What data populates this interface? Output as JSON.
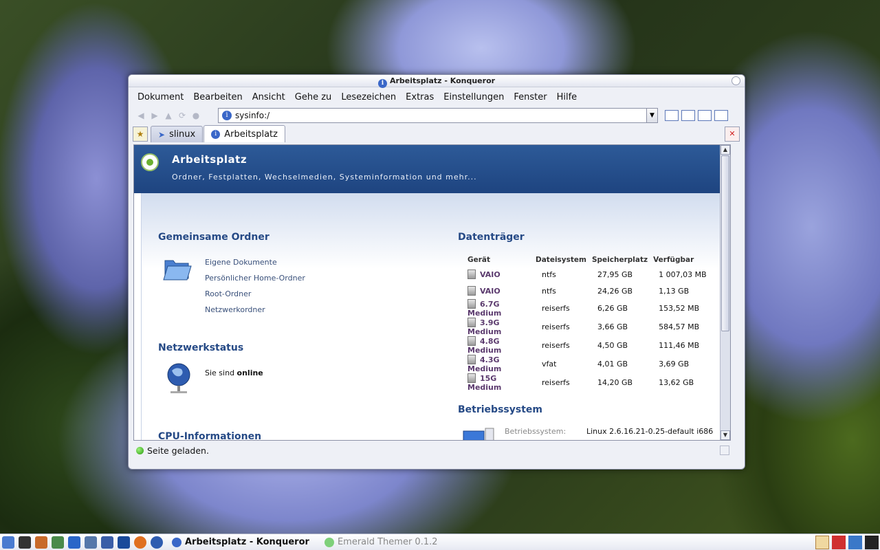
{
  "window": {
    "title": "Arbeitsplatz -  Konqueror"
  },
  "menu": [
    "Dokument",
    "Bearbeiten",
    "Ansicht",
    "Gehe zu",
    "Lesezeichen",
    "Extras",
    "Einstellungen",
    "Fenster",
    "Hilfe"
  ],
  "location": {
    "value": "sysinfo:/"
  },
  "tabs": [
    {
      "label": "slinux"
    },
    {
      "label": "Arbeitsplatz"
    }
  ],
  "banner": {
    "title": "Arbeitsplatz",
    "subtitle": "Ordner, Festplatten, Wechselmedien, Systeminformation und mehr..."
  },
  "shared_folders": {
    "heading": "Gemeinsame Ordner",
    "links": [
      "Eigene Dokumente",
      "Persönlicher Home-Ordner",
      "Root-Ordner",
      "Netzwerkordner"
    ]
  },
  "network": {
    "heading": "Netzwerkstatus",
    "text_prefix": "Sie sind",
    "status": "online"
  },
  "cpu": {
    "heading": "CPU-Informationen"
  },
  "disks": {
    "heading": "Datenträger",
    "columns": [
      "Gerät",
      "Dateisystem",
      "Speicherplatz",
      "Verfügbar"
    ],
    "rows": [
      {
        "device": "VAIO",
        "fs": "ntfs",
        "size": "27,95 GB",
        "free": "1 007,03 MB"
      },
      {
        "device": "VAIO",
        "fs": "ntfs",
        "size": "24,26 GB",
        "free": "1,13 GB"
      },
      {
        "device": "6.7G Medium",
        "fs": "reiserfs",
        "size": "6,26 GB",
        "free": "153,52 MB"
      },
      {
        "device": "3.9G Medium",
        "fs": "reiserfs",
        "size": "3,66 GB",
        "free": "584,57 MB"
      },
      {
        "device": "4.8G Medium",
        "fs": "reiserfs",
        "size": "4,50 GB",
        "free": "111,46 MB"
      },
      {
        "device": "4.3G Medium",
        "fs": "vfat",
        "size": "4,01 GB",
        "free": "3,69 GB"
      },
      {
        "device": "15G Medium",
        "fs": "reiserfs",
        "size": "14,20 GB",
        "free": "13,62 GB"
      }
    ]
  },
  "os": {
    "heading": "Betriebssystem",
    "label": "Betriebssystem:",
    "value": "Linux 2.6.16.21-0.25-default i686"
  },
  "status": {
    "text": "Seite geladen."
  },
  "taskbar": {
    "active_task": "Arbeitsplatz - Konqueror",
    "inactive_task": "Emerald Themer 0.1.2"
  },
  "colors": {
    "banner": "#1e4480",
    "heading": "#264a86",
    "device": "#5b3a6e"
  }
}
